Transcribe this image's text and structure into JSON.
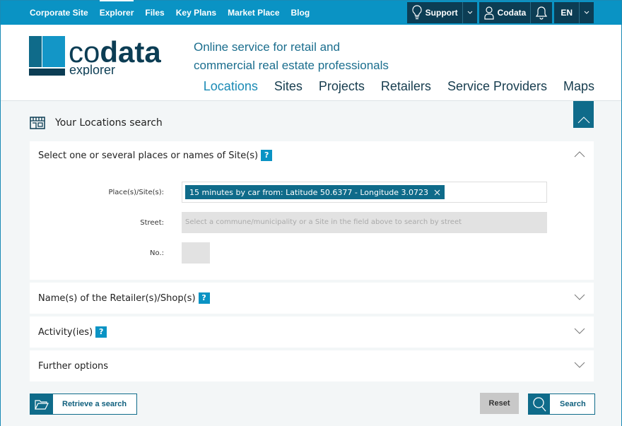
{
  "topnav": [
    "Corporate Site",
    "Explorer",
    "Files",
    "Key Plans",
    "Market Place",
    "Blog"
  ],
  "tools": {
    "support": "Support",
    "user": "Codata",
    "lang": "EN"
  },
  "logo": {
    "name": "codata",
    "sub": "explorer"
  },
  "tagline": [
    "Online service for retail and",
    "commercial real estate professionals"
  ],
  "mainnav": [
    "Locations",
    "Sites",
    "Projects",
    "Retailers",
    "Service Providers",
    "Maps"
  ],
  "search": {
    "title": "Your Locations search",
    "sections": [
      "Select one or several places or names of Site(s)",
      "Name(s) of the Retailer(s)/Shop(s)",
      "Activity(ies)",
      "Further options"
    ],
    "help": "?",
    "place_label": "Place(s)/Site(s):",
    "place_tag": "15 minutes by car from: Latitude 50.6377 - Longitude 3.0723",
    "street_label": "Street:",
    "street_placeholder": "Select a commune/municipality or a Site in the field above to search by street",
    "no_label": "No.:"
  },
  "buttons": {
    "retrieve": "Retrieve a search",
    "reset": "Reset",
    "search": "Search"
  },
  "colors": {
    "primary": "#0a93c4",
    "dark": "#0c3d54",
    "accent": "#0f6b8a"
  }
}
